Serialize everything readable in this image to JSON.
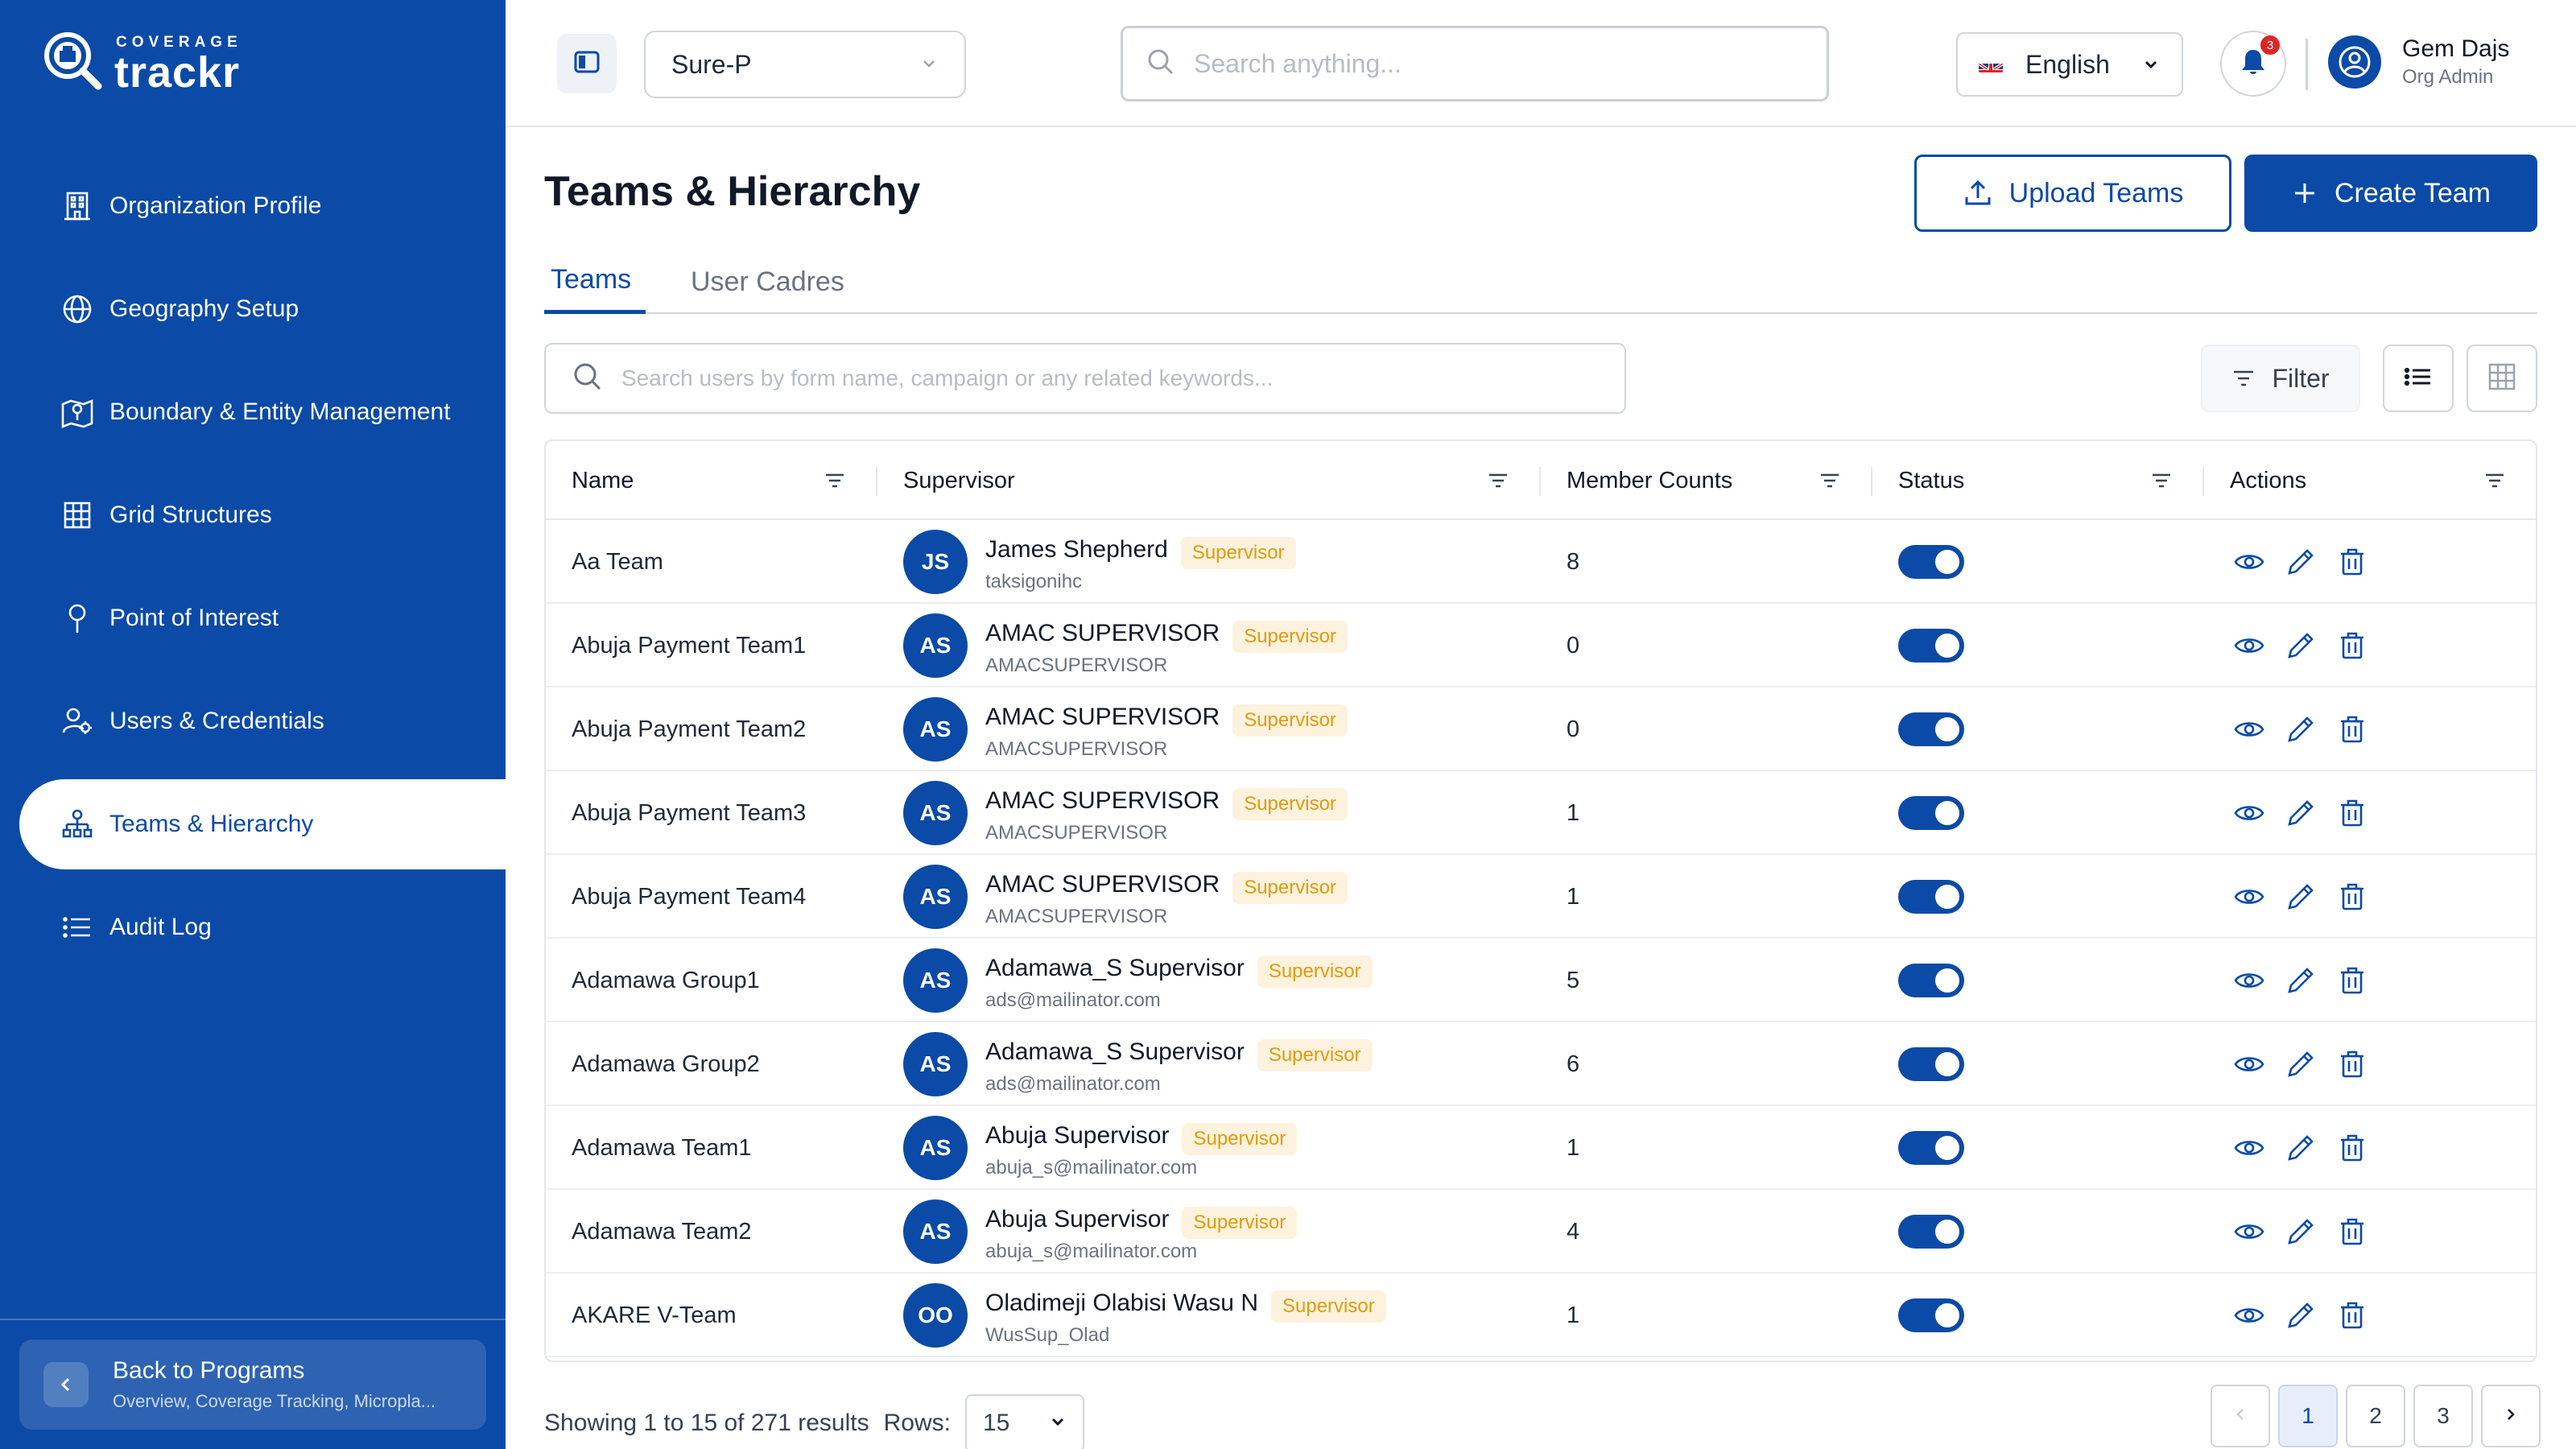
{
  "brand": {
    "small": "COVERAGE",
    "big": "trackr"
  },
  "sidebar": {
    "items": [
      {
        "label": "Organization Profile",
        "icon": "building-icon"
      },
      {
        "label": "Geography Setup",
        "icon": "globe-icon"
      },
      {
        "label": "Boundary & Entity Management",
        "icon": "map-pin-icon"
      },
      {
        "label": "Grid Structures",
        "icon": "grid-icon"
      },
      {
        "label": "Point of Interest",
        "icon": "location-pin-icon"
      },
      {
        "label": "Users & Credentials",
        "icon": "users-gear-icon"
      },
      {
        "label": "Teams & Hierarchy",
        "icon": "hierarchy-icon",
        "active": true
      },
      {
        "label": "Audit Log",
        "icon": "list-icon"
      }
    ],
    "back": {
      "title": "Back to Programs",
      "subtitle": "Overview, Coverage Tracking, Micropla..."
    }
  },
  "topbar": {
    "program": "Sure-P",
    "search_placeholder": "Search anything...",
    "language": "English",
    "notifications": "3",
    "user_name": "Gem Dajs",
    "user_role": "Org Admin"
  },
  "page": {
    "title": "Teams & Hierarchy",
    "upload_label": "Upload Teams",
    "create_label": "Create Team",
    "tabs": [
      "Teams",
      "User Cadres"
    ],
    "table_search_placeholder": "Search users by form name, campaign or any related keywords...",
    "filter_label": "Filter"
  },
  "table": {
    "headers": [
      "Name",
      "Supervisor",
      "Member Counts",
      "Status",
      "Actions"
    ],
    "badge_label": "Supervisor",
    "rows": [
      {
        "name": "Aa Team",
        "initials": "JS",
        "sup_name": "James Shepherd",
        "sup_sub": "taksigonihc",
        "count": "8",
        "active": true
      },
      {
        "name": "Abuja Payment Team1",
        "initials": "AS",
        "sup_name": "AMAC SUPERVISOR",
        "sup_sub": "AMACSUPERVISOR",
        "count": "0",
        "active": true
      },
      {
        "name": "Abuja Payment Team2",
        "initials": "AS",
        "sup_name": "AMAC SUPERVISOR",
        "sup_sub": "AMACSUPERVISOR",
        "count": "0",
        "active": true
      },
      {
        "name": "Abuja Payment Team3",
        "initials": "AS",
        "sup_name": "AMAC SUPERVISOR",
        "sup_sub": "AMACSUPERVISOR",
        "count": "1",
        "active": true
      },
      {
        "name": "Abuja Payment Team4",
        "initials": "AS",
        "sup_name": "AMAC SUPERVISOR",
        "sup_sub": "AMACSUPERVISOR",
        "count": "1",
        "active": true
      },
      {
        "name": "Adamawa Group1",
        "initials": "AS",
        "sup_name": "Adamawa_S Supervisor",
        "sup_sub": "ads@mailinator.com",
        "count": "5",
        "active": true
      },
      {
        "name": "Adamawa Group2",
        "initials": "AS",
        "sup_name": "Adamawa_S Supervisor",
        "sup_sub": "ads@mailinator.com",
        "count": "6",
        "active": true
      },
      {
        "name": "Adamawa Team1",
        "initials": "AS",
        "sup_name": "Abuja Supervisor",
        "sup_sub": "abuja_s@mailinator.com",
        "count": "1",
        "active": true
      },
      {
        "name": "Adamawa Team2",
        "initials": "AS",
        "sup_name": "Abuja Supervisor",
        "sup_sub": "abuja_s@mailinator.com",
        "count": "4",
        "active": true
      },
      {
        "name": "AKARE V-Team",
        "initials": "OO",
        "sup_name": "Oladimeji Olabisi Wasu N",
        "sup_sub": "WusSup_Olad",
        "count": "1",
        "active": true
      }
    ]
  },
  "footer": {
    "showing": "Showing 1 to 15 of 271 results",
    "rows_label": "Rows:",
    "rows_value": "15",
    "pages": [
      "1",
      "2",
      "3"
    ]
  },
  "colors": {
    "primary": "#0b4aa6",
    "badge_bg": "#fdf2dd",
    "badge_text": "#e39a0b"
  }
}
